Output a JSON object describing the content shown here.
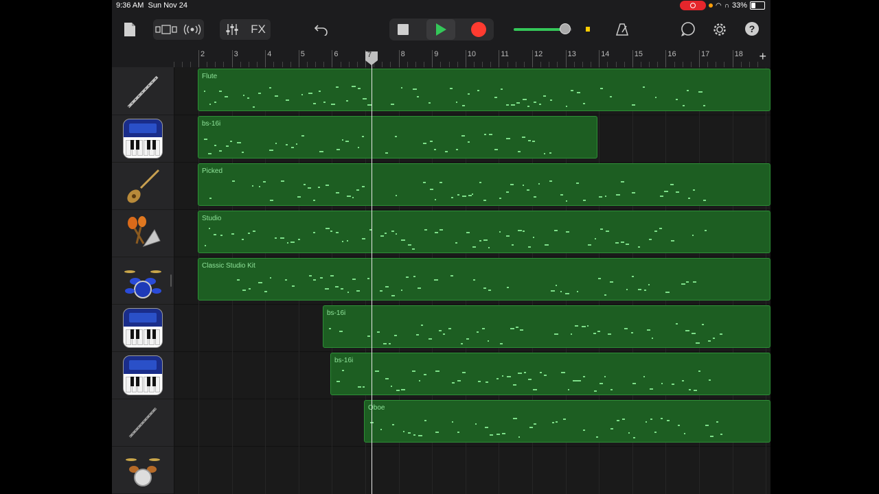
{
  "status_bar": {
    "time": "9:36 AM",
    "date": "Sun Nov 24",
    "battery": "33%"
  },
  "toolbar": {
    "fx_label": "FX",
    "help_label": "?"
  },
  "ruler": {
    "bars": [
      "2",
      "3",
      "4",
      "5",
      "6",
      "7",
      "8",
      "9",
      "10",
      "11",
      "12",
      "13",
      "14",
      "15",
      "16",
      "17",
      "18"
    ],
    "playhead_bar": "7",
    "add_label": "+"
  },
  "tracks": [
    {
      "instrument_icon": "flute-icon",
      "region_label": "Flute"
    },
    {
      "instrument_icon": "synth-keyboard-icon",
      "region_label": "bs-16i"
    },
    {
      "instrument_icon": "bass-guitar-icon",
      "region_label": "Picked"
    },
    {
      "instrument_icon": "percussion-icon",
      "region_label": "Studio"
    },
    {
      "instrument_icon": "drum-kit-icon",
      "region_label": "Classic Studio Kit"
    },
    {
      "instrument_icon": "synth-keyboard-icon",
      "region_label": "bs-16i"
    },
    {
      "instrument_icon": "synth-keyboard-icon",
      "region_label": "bs-16i"
    },
    {
      "instrument_icon": "oboe-icon",
      "region_label": "Oboe"
    },
    {
      "instrument_icon": "drum-kit-icon",
      "region_label": ""
    }
  ],
  "colors": {
    "region_fill": "#1d5e22",
    "region_border": "#2d8f36",
    "note": "#7ee08a",
    "play": "#34c759",
    "record": "#ff3b30"
  }
}
